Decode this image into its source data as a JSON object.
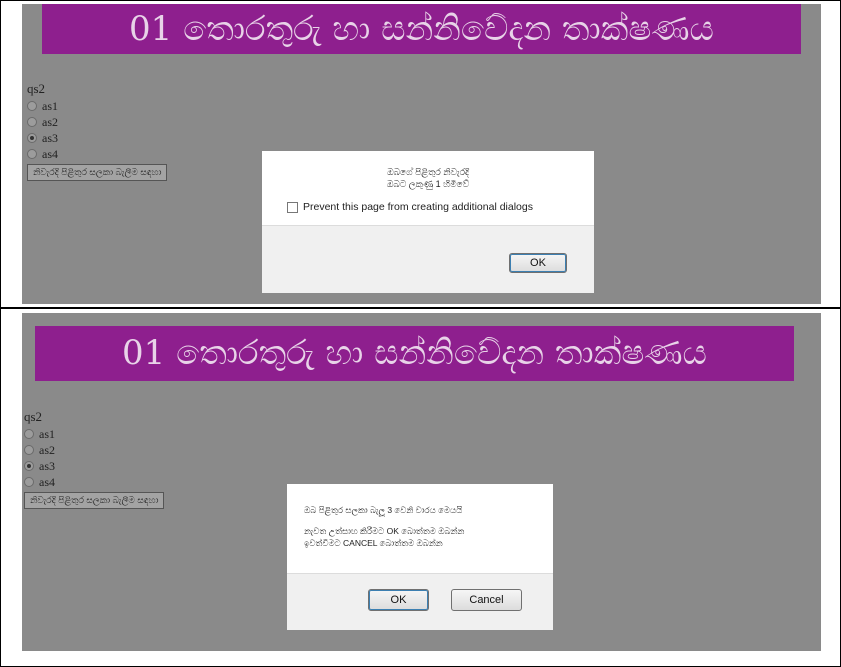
{
  "top": {
    "banner_title": "01 තොරතුරු හා සන්නිවේදන තාක්ෂණය",
    "question_label": "qs2",
    "options": [
      "as1",
      "as2",
      "as3",
      "as4"
    ],
    "selected": "as3",
    "submit_label": "නිවැරදි පිළිතුර සලකා බැලීම සඳහා",
    "dialog": {
      "line1": "ඔබගේ පිළිතුර නිවැරදි",
      "line2": "ඔබට ලකුණු 1 හිමිවේ",
      "checkbox_label": "Prevent this page from creating additional dialogs",
      "ok_label": "OK"
    }
  },
  "bottom": {
    "banner_title": "01 තොරතුරු හා සන්නිවේදන තාක්ෂණය",
    "question_label": "qs2",
    "options": [
      "as1",
      "as2",
      "as3",
      "as4"
    ],
    "selected": "as3",
    "submit_label": "නිවැරදි පිළිතුර සලකා බැලීම සඳහා",
    "dialog": {
      "line1": "ඔබ පිළිතුර සලකා බැලූ 3 වෙනි වාරය මෙයයි",
      "line2": "නැවත උත්සාහ කිරීමට OK බොත්තම ඔබන්න",
      "line3": "ඉවත්වීමට CANCEL බොත්තම ඔබන්න",
      "ok_label": "OK",
      "cancel_label": "Cancel"
    }
  },
  "colors": {
    "page_background": "#8a8a8a",
    "banner_background": "#8e1f8e",
    "banner_text": "#e8d3e8",
    "dialog_background": "#ffffff"
  }
}
